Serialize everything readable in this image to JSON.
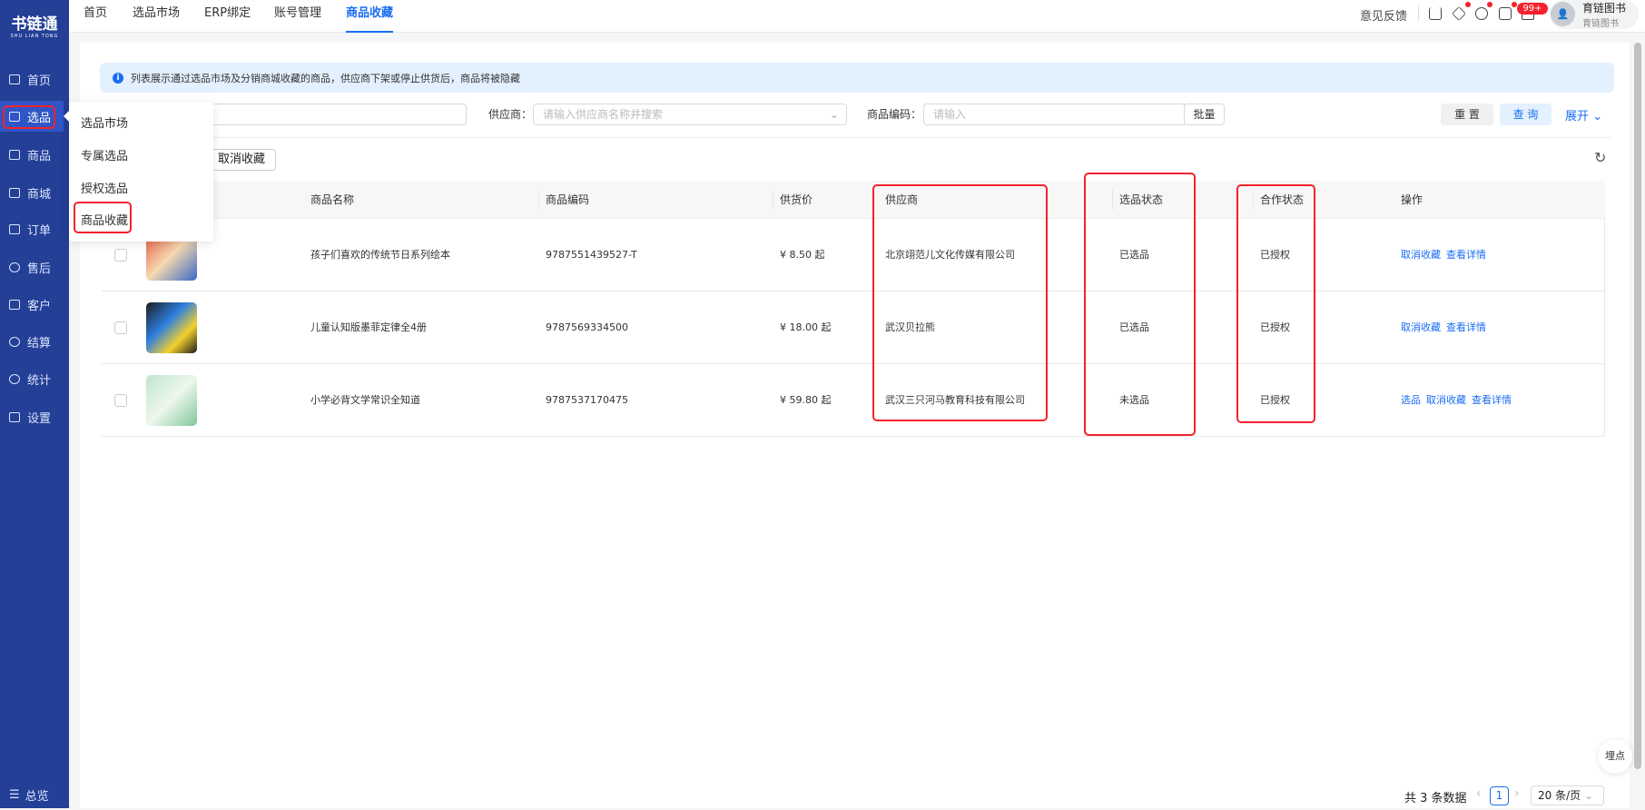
{
  "sidebar": {
    "logo": "书链通",
    "logo_sub": "SHU LIAN TONG",
    "items": [
      {
        "label": "首页",
        "icon": "monitor-icon"
      },
      {
        "label": "选品",
        "icon": "checklist-icon"
      },
      {
        "label": "商品",
        "icon": "box-icon"
      },
      {
        "label": "商城",
        "icon": "store-icon"
      },
      {
        "label": "订单",
        "icon": "document-icon"
      },
      {
        "label": "售后",
        "icon": "headset-icon"
      },
      {
        "label": "客户",
        "icon": "users-icon"
      },
      {
        "label": "结算",
        "icon": "settle-icon"
      },
      {
        "label": "统计",
        "icon": "clock-icon"
      },
      {
        "label": "设置",
        "icon": "sliders-icon"
      }
    ],
    "bottom": "总览",
    "active": "选品"
  },
  "submenu": {
    "items": [
      "选品市场",
      "专属选品",
      "授权选品",
      "商品收藏"
    ],
    "active": "商品收藏"
  },
  "topnav": {
    "items": [
      "首页",
      "选品市场",
      "ERP绑定",
      "账号管理",
      "商品收藏"
    ],
    "active": "商品收藏"
  },
  "header": {
    "feedback": "意见反馈",
    "badge": "99+",
    "user_name": "育链图书",
    "user_org": "育链图书",
    "icons": [
      "upload-icon",
      "diamond-icon",
      "headset-icon",
      "robot-icon",
      "bell-icon"
    ]
  },
  "info": "列表展示通过选品市场及分销商城收藏的商品，供应商下架或停止供货后，商品将被隐藏",
  "filters": {
    "supplier_label": "供应商：",
    "supplier_placeholder": "请输入供应商名称并搜索",
    "code_label": "商品编码：",
    "code_placeholder": "请输入",
    "batch": "批量",
    "reset": "重 置",
    "query": "查 询",
    "expand": "展开"
  },
  "toolbar": {
    "cancel_fav": "取消收藏"
  },
  "table": {
    "columns": [
      "商品名称",
      "商品编码",
      "供货价",
      "供应商",
      "选品状态",
      "合作状态",
      "操作"
    ],
    "rows": [
      {
        "name": "孩子们喜欢的传统节日系列绘本",
        "code": "9787551439527-T",
        "price": "¥ 8.50 起",
        "supplier": "北京翊范儿文化传媒有限公司",
        "select_status": "已选品",
        "coop_status": "已授权",
        "actions": [
          "取消收藏",
          "查看详情"
        ]
      },
      {
        "name": "儿童认知版墨菲定律全4册",
        "code": "9787569334500",
        "price": "¥ 18.00 起",
        "supplier": "武汉贝拉熊",
        "select_status": "已选品",
        "coop_status": "已授权",
        "actions": [
          "取消收藏",
          "查看详情"
        ]
      },
      {
        "name": "小学必背文学常识全知道",
        "code": "9787537170475",
        "price": "¥ 59.80 起",
        "supplier": "武汉三只河马教育科技有限公司",
        "select_status": "未选品",
        "coop_status": "已授权",
        "actions": [
          "选品",
          "取消收藏",
          "查看详情"
        ]
      }
    ]
  },
  "pagination": {
    "total": "共 3 条数据",
    "page": "1",
    "page_size": "20 条/页"
  },
  "float_btn": "埋点",
  "colors": {
    "sidebar": "#233f96",
    "accent": "#1a6cf5",
    "highlight": "#f5222d"
  }
}
